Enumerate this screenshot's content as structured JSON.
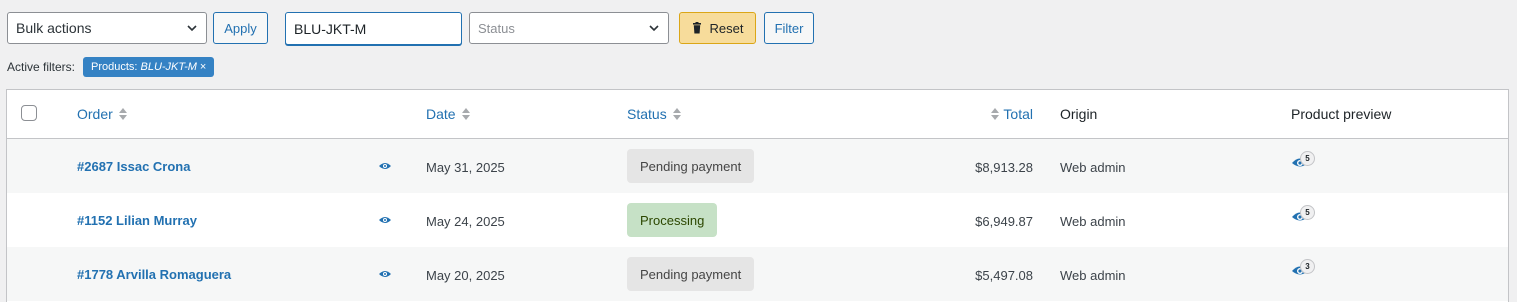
{
  "toolbar": {
    "bulk_actions_label": "Bulk actions",
    "apply_label": "Apply",
    "search_value": "BLU-JKT-M",
    "status_placeholder": "Status",
    "reset_label": "Reset",
    "filter_label": "Filter"
  },
  "active_filters": {
    "label": "Active filters:",
    "chip_prefix": "Products:",
    "chip_value": "BLU-JKT-M",
    "chip_remove": "×"
  },
  "table": {
    "headers": {
      "order": "Order",
      "date": "Date",
      "status": "Status",
      "total": "Total",
      "origin": "Origin",
      "product_preview": "Product preview"
    },
    "rows": [
      {
        "order": "#2687 Issac Crona",
        "date": "May 31, 2025",
        "status": "Pending payment",
        "status_type": "pending",
        "total": "$8,913.28",
        "origin": "Web admin",
        "preview_count": "5"
      },
      {
        "order": "#1152 Lilian Murray",
        "date": "May 24, 2025",
        "status": "Processing",
        "status_type": "processing",
        "total": "$6,949.87",
        "origin": "Web admin",
        "preview_count": "5"
      },
      {
        "order": "#1778 Arvilla Romaguera",
        "date": "May 20, 2025",
        "status": "Pending payment",
        "status_type": "pending",
        "total": "$5,497.08",
        "origin": "Web admin",
        "preview_count": "3"
      }
    ]
  },
  "colors": {
    "link": "#2271b1",
    "pending_bg": "#e5e5e5",
    "processing_bg": "#c6e1c6",
    "reset_bg": "#f7dc9b",
    "chip_bg": "#3582c4"
  },
  "icons": [
    "chevron-down-icon",
    "trash-icon",
    "sort-icon",
    "eye-icon"
  ]
}
